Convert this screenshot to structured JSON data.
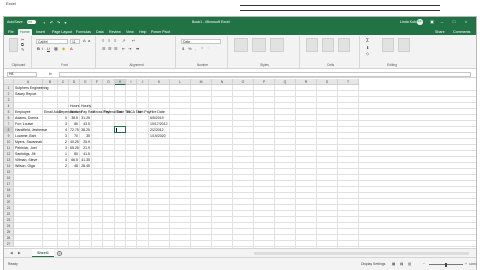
{
  "outer": {
    "label": "Excel"
  },
  "titlebar": {
    "autosave_label": "AutoSave",
    "autosave_state": "Off",
    "document_title": "Book1 - Microsoft Excel",
    "user_name": "Linda Koho",
    "user_initials": "LK"
  },
  "ribbon_tabs": [
    "File",
    "Home",
    "Insert",
    "Page Layout",
    "Formulas",
    "Data",
    "Review",
    "View",
    "Help",
    "Power Pivot"
  ],
  "ribbon_right": {
    "share": "Share",
    "comments": "Comments"
  },
  "ribbon": {
    "font_name": "Calibri",
    "font_size": "11",
    "number_format": "Date",
    "groups": [
      "Clipboard",
      "Font",
      "Alignment",
      "Number",
      "Styles",
      "Cells",
      "Editing"
    ]
  },
  "formula_bar": {
    "name_box": "H8",
    "fx": "fx",
    "content": ""
  },
  "columns": [
    "A",
    "B",
    "C",
    "D",
    "E",
    "F",
    "G",
    "H",
    "I",
    "J",
    "K",
    "L",
    "M",
    "N",
    "O",
    "P",
    "Q",
    "R",
    "S",
    "T"
  ],
  "rows": [
    "1",
    "2",
    "3",
    "4",
    "5",
    "6",
    "7",
    "8",
    "9",
    "10",
    "11",
    "12",
    "13",
    "14",
    "15",
    "16",
    "17",
    "18",
    "19",
    "20",
    "21",
    "22",
    "23",
    "24",
    "25",
    "26",
    "27"
  ],
  "sheet": {
    "title1": "Sulphers Engineering",
    "title2": "Salary Report",
    "header_top": {
      "hours": "Hours",
      "hourly": "Hourly"
    },
    "headers": [
      "Employee",
      "Email Addr",
      "Dependants",
      "Worked",
      "Pay Rate",
      "Gross Pay",
      "Federal Tax",
      "State Tax",
      "FICA Tax",
      "Net Pay",
      "Hire Date"
    ],
    "employees": [
      {
        "name": "Adams, Donna",
        "dep": "0",
        "hours": "38.5",
        "rate": "31.25",
        "hire": "6/5/2019"
      },
      {
        "name": "Fox, Louise",
        "dep": "3",
        "hours": "80",
        "rate": "43.5",
        "hire": "10/17/2012"
      },
      {
        "name": "Handfield, Jeshemar",
        "dep": "4",
        "hours": "72.75",
        "rate": "38.25",
        "hire": "2/2/2012"
      },
      {
        "name": "Lozame, Bart",
        "dep": "3",
        "hours": "70",
        "rate": "35",
        "hire": "1/19/2020"
      },
      {
        "name": "Myers, Savannah",
        "dep": "2",
        "hours": "40.25",
        "rate": "25.9",
        "hire": ""
      },
      {
        "name": "Pehlnick, Joel",
        "dep": "3",
        "hours": "65.25",
        "rate": "21.9",
        "hire": ""
      },
      {
        "name": "Santidigs, Jill",
        "dep": "1",
        "hours": "80",
        "rate": "41.5",
        "hire": ""
      },
      {
        "name": "Villman, Steve",
        "dep": "4",
        "hours": "66.5",
        "rate": "41.35",
        "hire": ""
      },
      {
        "name": "Wilson, Olga",
        "dep": "2",
        "hours": "48",
        "rate": "28.45",
        "hire": ""
      }
    ]
  },
  "sheet_tabs": {
    "active": "Sheet1",
    "add": "+"
  },
  "statusbar": {
    "mode": "Ready",
    "display_settings": "Display Settings",
    "zoom": "100%"
  }
}
